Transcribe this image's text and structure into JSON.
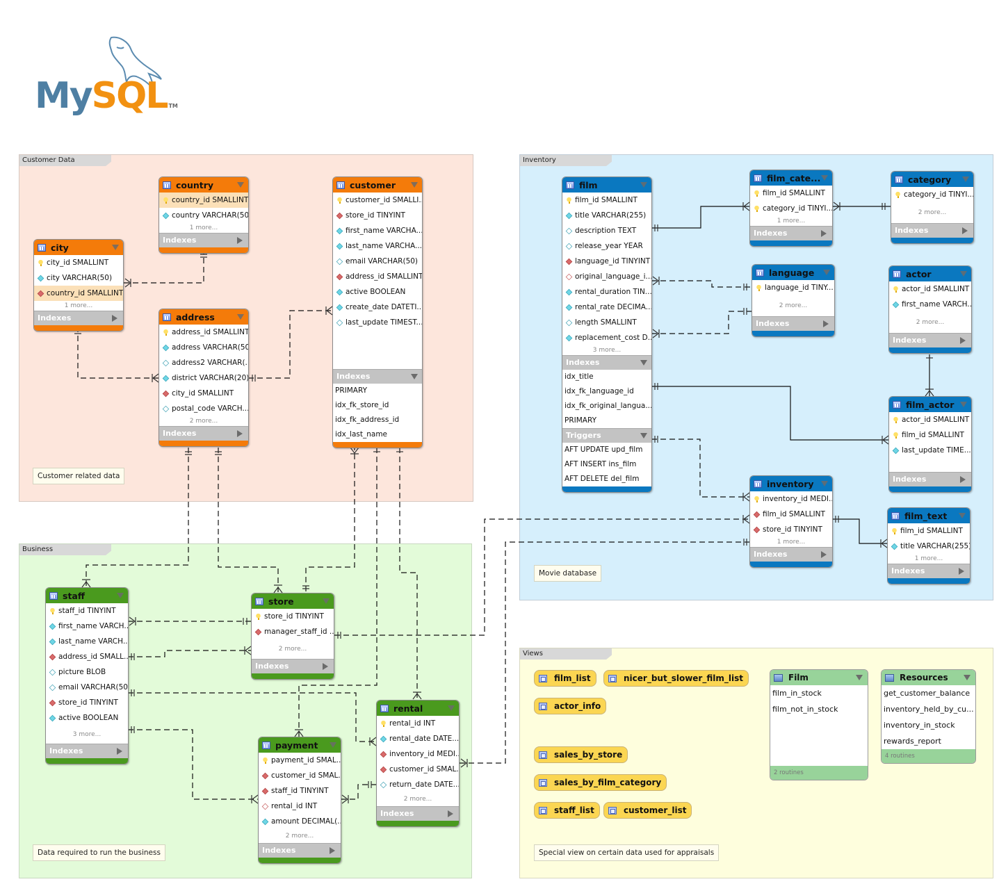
{
  "logo": {
    "text_my": "My",
    "text_sql": "SQL",
    "tm": "TM"
  },
  "layers": {
    "customer": {
      "label": "Customer Data",
      "note": "Customer related data",
      "color": "#fde6dc"
    },
    "business": {
      "label": "Business",
      "note": "Data required to run the business",
      "color": "#e3fbd9"
    },
    "inventory": {
      "label": "Inventory",
      "note": "Movie database",
      "color": "#d6effc"
    },
    "views": {
      "label": "Views",
      "note": "Special view on certain data used for appraisals",
      "color": "#fefedd"
    }
  },
  "section_labels": {
    "indexes": "Indexes",
    "triggers": "Triggers"
  },
  "tables": {
    "country": {
      "name": "country",
      "columns": [
        {
          "icon": "pk",
          "text": "country_id SMALLINT"
        },
        {
          "icon": "nn",
          "text": "country VARCHAR(50)"
        }
      ],
      "more": "1 more..."
    },
    "city": {
      "name": "city",
      "columns": [
        {
          "icon": "pk",
          "text": "city_id SMALLINT"
        },
        {
          "icon": "nn",
          "text": "city VARCHAR(50)"
        },
        {
          "icon": "fk",
          "text": "country_id SMALLINT"
        }
      ],
      "more": "1 more..."
    },
    "address": {
      "name": "address",
      "columns": [
        {
          "icon": "pk",
          "text": "address_id SMALLINT"
        },
        {
          "icon": "nn",
          "text": "address VARCHAR(50)"
        },
        {
          "icon": "col",
          "text": "address2 VARCHAR(..."
        },
        {
          "icon": "nn",
          "text": "district VARCHAR(20)"
        },
        {
          "icon": "fk",
          "text": "city_id SMALLINT"
        },
        {
          "icon": "col",
          "text": "postal_code VARCH..."
        }
      ],
      "more": "2 more..."
    },
    "customer": {
      "name": "customer",
      "columns": [
        {
          "icon": "pk",
          "text": "customer_id SMALLI..."
        },
        {
          "icon": "fk",
          "text": "store_id TINYINT"
        },
        {
          "icon": "nn",
          "text": "first_name VARCHA..."
        },
        {
          "icon": "nn",
          "text": "last_name VARCHA..."
        },
        {
          "icon": "col",
          "text": "email VARCHAR(50)"
        },
        {
          "icon": "fk",
          "text": "address_id SMALLINT"
        },
        {
          "icon": "nn",
          "text": "active BOOLEAN"
        },
        {
          "icon": "nn",
          "text": "create_date DATETI..."
        },
        {
          "icon": "col",
          "text": "last_update TIMEST..."
        }
      ],
      "indexes": [
        "PRIMARY",
        "idx_fk_store_id",
        "idx_fk_address_id",
        "idx_last_name"
      ]
    },
    "film": {
      "name": "film",
      "columns": [
        {
          "icon": "pk",
          "text": "film_id SMALLINT"
        },
        {
          "icon": "nn",
          "text": "title VARCHAR(255)"
        },
        {
          "icon": "col",
          "text": "description TEXT"
        },
        {
          "icon": "col",
          "text": "release_year YEAR"
        },
        {
          "icon": "fk",
          "text": "language_id TINYINT"
        },
        {
          "icon": "fko",
          "text": "original_language_i..."
        },
        {
          "icon": "nn",
          "text": "rental_duration TIN..."
        },
        {
          "icon": "nn",
          "text": "rental_rate DECIMA..."
        },
        {
          "icon": "col",
          "text": "length SMALLINT"
        },
        {
          "icon": "nn",
          "text": "replacement_cost D..."
        }
      ],
      "more": "3 more...",
      "indexes": [
        "idx_title",
        "idx_fk_language_id",
        "idx_fk_original_langua...",
        "PRIMARY"
      ],
      "triggers": [
        "AFT UPDATE upd_film",
        "AFT INSERT ins_film",
        "AFT DELETE del_film"
      ]
    },
    "film_category": {
      "name": "film_cate...",
      "columns": [
        {
          "icon": "pk",
          "text": "film_id SMALLINT"
        },
        {
          "icon": "pk",
          "text": "category_id TINYI..."
        }
      ],
      "more": "1 more..."
    },
    "category": {
      "name": "category",
      "columns": [
        {
          "icon": "pk",
          "text": "category_id TINYI..."
        }
      ],
      "more": "2 more..."
    },
    "language": {
      "name": "language",
      "columns": [
        {
          "icon": "pk",
          "text": "language_id TINY..."
        }
      ],
      "more": "2 more..."
    },
    "actor": {
      "name": "actor",
      "columns": [
        {
          "icon": "pk",
          "text": "actor_id SMALLINT"
        },
        {
          "icon": "nn",
          "text": "first_name VARCH..."
        }
      ],
      "more": "2 more..."
    },
    "film_actor": {
      "name": "film_actor",
      "columns": [
        {
          "icon": "pk",
          "text": "actor_id SMALLINT"
        },
        {
          "icon": "pk",
          "text": "film_id SMALLINT"
        },
        {
          "icon": "nn",
          "text": "last_update TIME..."
        }
      ]
    },
    "inventory": {
      "name": "inventory",
      "columns": [
        {
          "icon": "pk",
          "text": "inventory_id MEDI..."
        },
        {
          "icon": "fk",
          "text": "film_id SMALLINT"
        },
        {
          "icon": "fk",
          "text": "store_id TINYINT"
        }
      ],
      "more": "1 more..."
    },
    "film_text": {
      "name": "film_text",
      "columns": [
        {
          "icon": "pk",
          "text": "film_id SMALLINT"
        },
        {
          "icon": "nn",
          "text": "title VARCHAR(255)"
        }
      ],
      "more": "1 more..."
    },
    "staff": {
      "name": "staff",
      "columns": [
        {
          "icon": "pk",
          "text": "staff_id TINYINT"
        },
        {
          "icon": "nn",
          "text": "first_name VARCH..."
        },
        {
          "icon": "nn",
          "text": "last_name VARCH..."
        },
        {
          "icon": "fk",
          "text": "address_id SMALL..."
        },
        {
          "icon": "col",
          "text": "picture BLOB"
        },
        {
          "icon": "col",
          "text": "email VARCHAR(50)"
        },
        {
          "icon": "fk",
          "text": "store_id TINYINT"
        },
        {
          "icon": "nn",
          "text": "active BOOLEAN"
        }
      ],
      "more": "3 more..."
    },
    "store": {
      "name": "store",
      "columns": [
        {
          "icon": "pk",
          "text": "store_id TINYINT"
        },
        {
          "icon": "fk",
          "text": "manager_staff_id ..."
        }
      ],
      "more": "2 more..."
    },
    "payment": {
      "name": "payment",
      "columns": [
        {
          "icon": "pk",
          "text": "payment_id SMAL..."
        },
        {
          "icon": "fk",
          "text": "customer_id SMAL..."
        },
        {
          "icon": "fk",
          "text": "staff_id TINYINT"
        },
        {
          "icon": "fko",
          "text": "rental_id INT"
        },
        {
          "icon": "nn",
          "text": "amount DECIMAL(..."
        }
      ],
      "more": "2 more..."
    },
    "rental": {
      "name": "rental",
      "columns": [
        {
          "icon": "pk",
          "text": "rental_id INT"
        },
        {
          "icon": "nn",
          "text": "rental_date DATE..."
        },
        {
          "icon": "fk",
          "text": "inventory_id MEDI..."
        },
        {
          "icon": "fk",
          "text": "customer_id SMAL..."
        },
        {
          "icon": "col",
          "text": "return_date DATE..."
        }
      ],
      "more": "2 more..."
    }
  },
  "views": [
    "film_list",
    "nicer_but_slower_film_list",
    "actor_info",
    "sales_by_store",
    "sales_by_film_category",
    "staff_list",
    "customer_list"
  ],
  "routine_groups": {
    "film": {
      "name": "Film",
      "items": [
        "film_in_stock",
        "film_not_in_stock"
      ],
      "footer": "2 routines"
    },
    "resources": {
      "name": "Resources",
      "items": [
        "get_customer_balance",
        "inventory_held_by_cu...",
        "inventory_in_stock",
        "rewards_report"
      ],
      "footer": "4 routines"
    }
  }
}
